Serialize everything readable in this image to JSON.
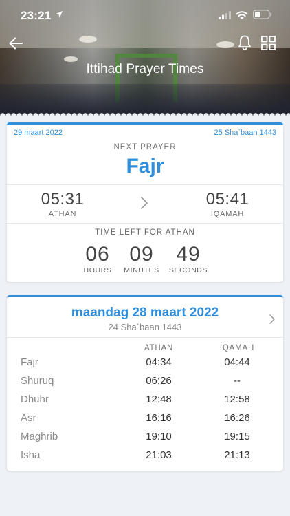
{
  "status_bar": {
    "time": "23:21",
    "icons": [
      "location-arrow-icon",
      "cellular-signal-icon",
      "wifi-icon",
      "battery-icon"
    ]
  },
  "header": {
    "title": "Ittihad Prayer Times",
    "icons": [
      "back-arrow-icon",
      "bell-icon",
      "grid-icon"
    ]
  },
  "next_prayer": {
    "gregorian_date": "29 maart 2022",
    "hijri_date": "25 Sha`baan 1443",
    "label": "NEXT PRAYER",
    "name": "Fajr",
    "athan_time": "05:31",
    "athan_label": "ATHAN",
    "iqamah_time": "05:41",
    "iqamah_label": "IQAMAH",
    "time_left_label": "TIME LEFT FOR ATHAN",
    "countdown": {
      "hours": "06",
      "hours_label": "HOURS",
      "minutes": "09",
      "minutes_label": "MINUTES",
      "seconds": "49",
      "seconds_label": "SECONDS"
    }
  },
  "day_schedule": {
    "title": "maandag 28 maart 2022",
    "hijri": "24 Sha`baan 1443",
    "columns": {
      "athan": "ATHAN",
      "iqamah": "IQAMAH"
    },
    "rows": [
      {
        "name": "Fajr",
        "athan": "04:34",
        "iqamah": "04:44"
      },
      {
        "name": "Shuruq",
        "athan": "06:26",
        "iqamah": "--"
      },
      {
        "name": "Dhuhr",
        "athan": "12:48",
        "iqamah": "12:58"
      },
      {
        "name": "Asr",
        "athan": "16:16",
        "iqamah": "16:26"
      },
      {
        "name": "Maghrib",
        "athan": "19:10",
        "iqamah": "19:15"
      },
      {
        "name": "Isha",
        "athan": "21:03",
        "iqamah": "21:13"
      }
    ]
  },
  "colors": {
    "accent": "#2f8fdc",
    "background": "#eef1f6",
    "card": "#ffffff"
  }
}
